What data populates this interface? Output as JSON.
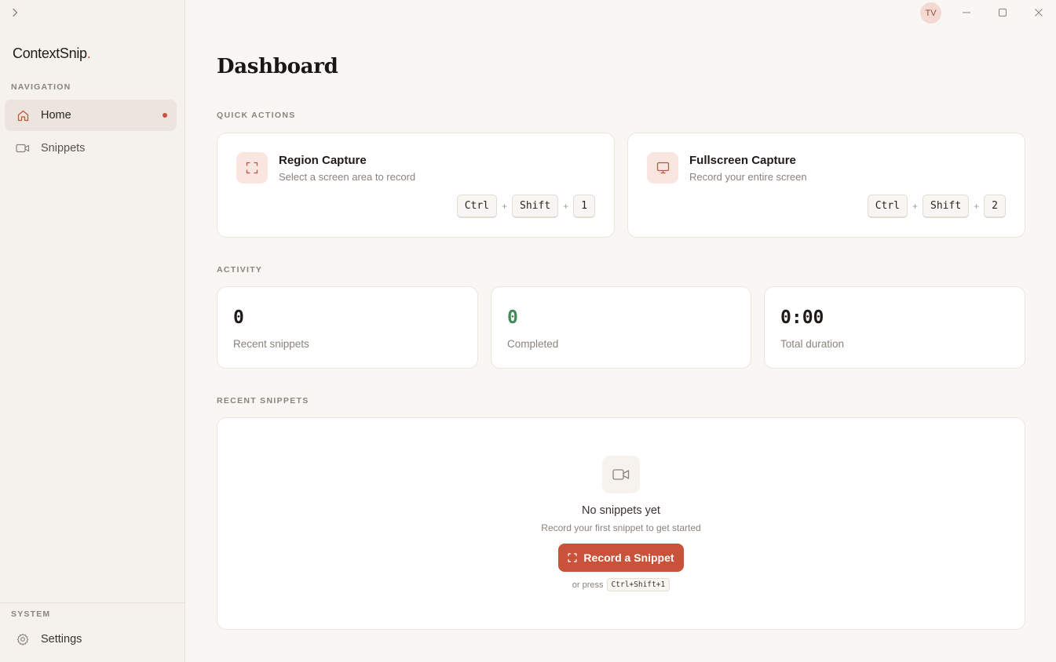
{
  "sidebar": {
    "brand": "ContextSnip",
    "brand_dot": ".",
    "navigation_label": "NAVIGATION",
    "items": [
      {
        "label": "Home",
        "icon": "home-icon",
        "active": true
      },
      {
        "label": "Snippets",
        "icon": "video-icon",
        "active": false
      }
    ],
    "system_label": "SYSTEM",
    "settings_label": "Settings"
  },
  "titlebar": {
    "avatar_initials": "TV"
  },
  "main": {
    "title": "Dashboard",
    "quick_actions_label": "QUICK ACTIONS",
    "quick_actions": [
      {
        "title": "Region Capture",
        "subtitle": "Select a screen area to record",
        "icon": "region-capture-icon",
        "keys": [
          "Ctrl",
          "Shift",
          "1"
        ]
      },
      {
        "title": "Fullscreen Capture",
        "subtitle": "Record your entire screen",
        "icon": "monitor-icon",
        "keys": [
          "Ctrl",
          "Shift",
          "2"
        ]
      }
    ],
    "plus": "+",
    "activity_label": "ACTIVITY",
    "stats": [
      {
        "value": "0",
        "label": "Recent snippets",
        "color": "#1f1b18"
      },
      {
        "value": "0",
        "label": "Completed",
        "color": "#3d8c5a"
      },
      {
        "value": "0:00",
        "label": "Total duration",
        "color": "#1f1b18"
      }
    ],
    "recent_label": "RECENT SNIPPETS",
    "empty": {
      "title": "No snippets yet",
      "subtitle": "Record your first snippet to get started",
      "button_label": "Record a Snippet",
      "or_press": "or press",
      "shortcut": "Ctrl+Shift+1"
    }
  },
  "colors": {
    "accent": "#c8533a",
    "success": "#3d8c5a"
  }
}
